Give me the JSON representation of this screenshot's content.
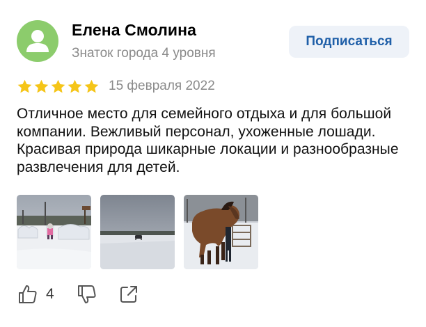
{
  "author": {
    "name": "Елена Смолина",
    "level": "Знаток города 4 уровня",
    "avatar_icon": "user-icon",
    "avatar_color": "#8ccc6c"
  },
  "subscribe_label": "Подписаться",
  "rating": {
    "stars": 5,
    "max": 5,
    "color": "#f5c518"
  },
  "date": "15 февраля 2022",
  "text": "Отличное место для семейного отдыха и для большой компании. Вежливый персонал, ухоженные лошади. Красивая природа шикарные локации и разнообразные развлечения для детей.",
  "photos": [
    {
      "subject": "child in snow by snow sculptures"
    },
    {
      "subject": "snowy field with car"
    },
    {
      "subject": "brown horse in snow"
    }
  ],
  "actions": {
    "like_icon": "thumbs-up-icon",
    "like_count": "4",
    "dislike_icon": "thumbs-down-icon",
    "share_icon": "share-icon"
  },
  "colors": {
    "link": "#1f5fa8",
    "muted": "#8a8a8a",
    "button_bg": "#eef2f8"
  }
}
